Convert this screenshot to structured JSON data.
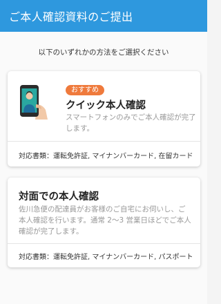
{
  "header": {
    "title": "ご本人確認資料のご提出"
  },
  "instruction": "以下のいずれかの方法をご選択ください",
  "card_quick": {
    "badge": "おすすめ",
    "title": "クイック本人確認",
    "description": "スマートフォンのみでご本人確認が完了します。",
    "documents": "対応書類：運転免許証, マイナンバーカード, 在留カード",
    "illustration": "smartphone-selfie-icon"
  },
  "card_inperson": {
    "title": "対面での本人確認",
    "description": "佐川急便の配達員がお客様のご自宅にお伺いし、ご本人確認を行います。通常 2～3 営業日ほどでご本人確認が完了します。",
    "documents": "対応書類：運転免許証, マイナンバーカード, パスポート"
  },
  "colors": {
    "header": "#2e98de",
    "badge": "#ef7a3c",
    "accent_teal": "#2aa8a0"
  }
}
